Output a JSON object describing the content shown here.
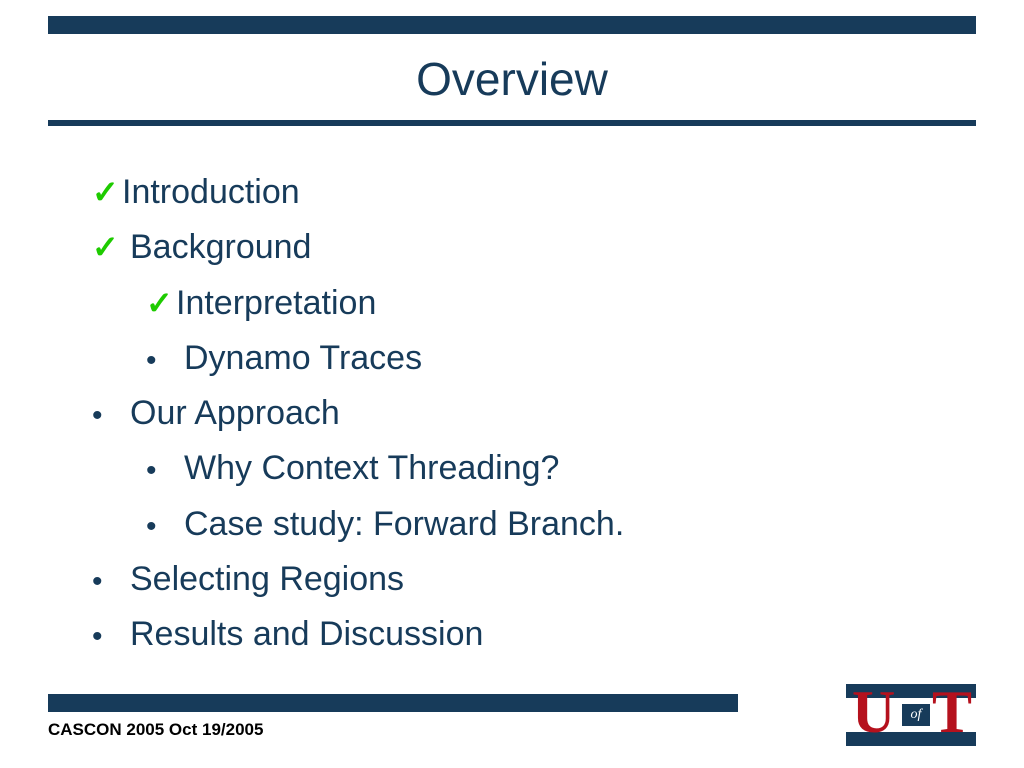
{
  "title": "Overview",
  "items": {
    "introduction": "Introduction",
    "background": " Background",
    "interpretation": "Interpretation",
    "dynamo": " Dynamo Traces",
    "approach": " Our Approach",
    "why": " Why Context Threading?",
    "case": " Case study: Forward Branch.",
    "selecting": " Selecting Regions",
    "results": " Results and Discussion"
  },
  "footer": "CASCON 2005 Oct 19/2005",
  "logo": {
    "u": "U",
    "of": "of",
    "t": "T"
  },
  "marks": {
    "check": "✓"
  }
}
